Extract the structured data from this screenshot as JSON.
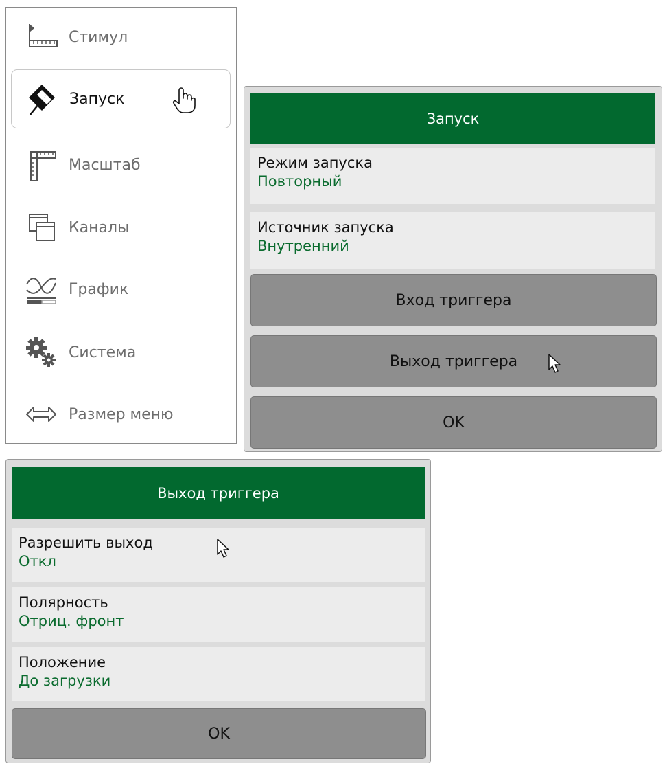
{
  "main_menu": {
    "items": [
      {
        "label": "Стимул",
        "icon": "ruler-icon",
        "active": false
      },
      {
        "label": "Запуск",
        "icon": "trigger-diamond-icon",
        "active": true
      },
      {
        "label": "Масштаб",
        "icon": "scale-icon",
        "active": false
      },
      {
        "label": "Каналы",
        "icon": "channels-icon",
        "active": false
      },
      {
        "label": "График",
        "icon": "graph-icon",
        "active": false
      },
      {
        "label": "Система",
        "icon": "gears-icon",
        "active": false
      },
      {
        "label": "Размер меню",
        "icon": "resize-arrows-icon",
        "active": false
      }
    ]
  },
  "trigger_panel": {
    "title": "Запуск",
    "mode_label": "Режим запуска",
    "mode_value": "Повторный",
    "source_label": "Источник запуска",
    "source_value": "Внутренний",
    "trigger_input_label": "Вход триггера",
    "trigger_output_label": "Выход триггера",
    "ok_label": "OK"
  },
  "trigger_output_panel": {
    "title": "Выход триггера",
    "enable_label": "Разрешить выход",
    "enable_value": "Откл",
    "polarity_label": "Полярность",
    "polarity_value": "Отриц. фронт",
    "position_label": "Положение",
    "position_value": "До загрузки",
    "ok_label": "OK"
  },
  "colors": {
    "header_green": "#02692f",
    "value_green": "#0a6b2e",
    "button_gray": "#8e8e8e",
    "panel_bg": "#dcdcdc"
  }
}
